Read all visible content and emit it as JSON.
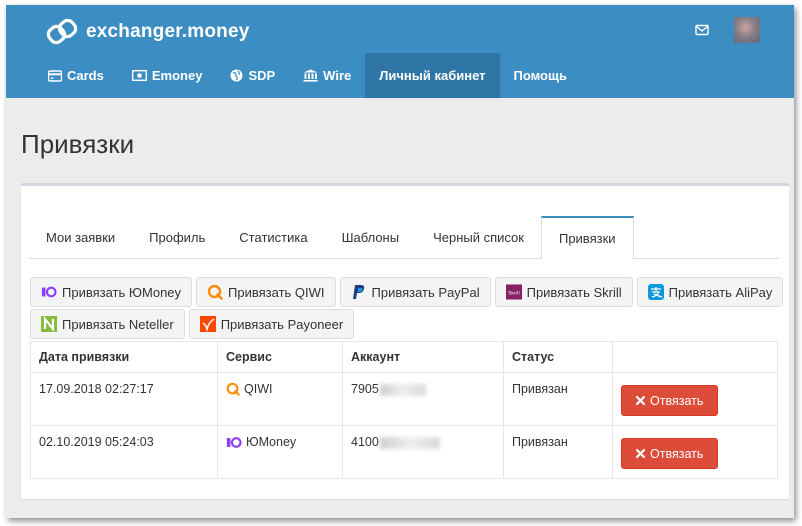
{
  "brand": {
    "name": "exchanger.money"
  },
  "colors": {
    "topbar": "#3c8dc2",
    "nav_active": "#2f75a6",
    "danger": "#dd4b39",
    "tab_accent": "#3c8dbc"
  },
  "nav": {
    "items": [
      {
        "label": "Cards",
        "icon": "credit-card-icon"
      },
      {
        "label": "Emoney",
        "icon": "money-icon"
      },
      {
        "label": "SDP",
        "icon": "globe-icon"
      },
      {
        "label": "Wire",
        "icon": "bank-icon"
      },
      {
        "label": "Личный кабинет",
        "active": true
      },
      {
        "label": "Помощь"
      }
    ]
  },
  "page": {
    "title": "Привязки"
  },
  "tabs": [
    {
      "label": "Мои заявки"
    },
    {
      "label": "Профиль"
    },
    {
      "label": "Статистика"
    },
    {
      "label": "Шаблоны"
    },
    {
      "label": "Черный список"
    },
    {
      "label": "Привязки",
      "active": true
    }
  ],
  "bind_buttons": [
    {
      "label": "Привязать ЮMoney",
      "icon": "yoomoney-icon"
    },
    {
      "label": "Привязать QIWI",
      "icon": "qiwi-icon"
    },
    {
      "label": "Привязать PayPal",
      "icon": "paypal-icon"
    },
    {
      "label": "Привязать Skrill",
      "icon": "skrill-icon"
    },
    {
      "label": "Привязать AliPay",
      "icon": "alipay-icon"
    },
    {
      "label": "Привязать Neteller",
      "icon": "neteller-icon"
    },
    {
      "label": "Привязать Payoneer",
      "icon": "payoneer-icon"
    }
  ],
  "table": {
    "headers": [
      "Дата привязки",
      "Сервис",
      "Аккаунт",
      "Статус",
      ""
    ],
    "rows": [
      {
        "date": "17.09.2018 02:27:17",
        "service": "QIWI",
        "service_icon": "qiwi-icon",
        "account": "7905",
        "status": "Привязан",
        "action": "Отвязать"
      },
      {
        "date": "02.10.2019 05:24:03",
        "service": "ЮMoney",
        "service_icon": "yoomoney-icon",
        "account": "4100",
        "status": "Привязан",
        "action": "Отвязать"
      }
    ]
  }
}
